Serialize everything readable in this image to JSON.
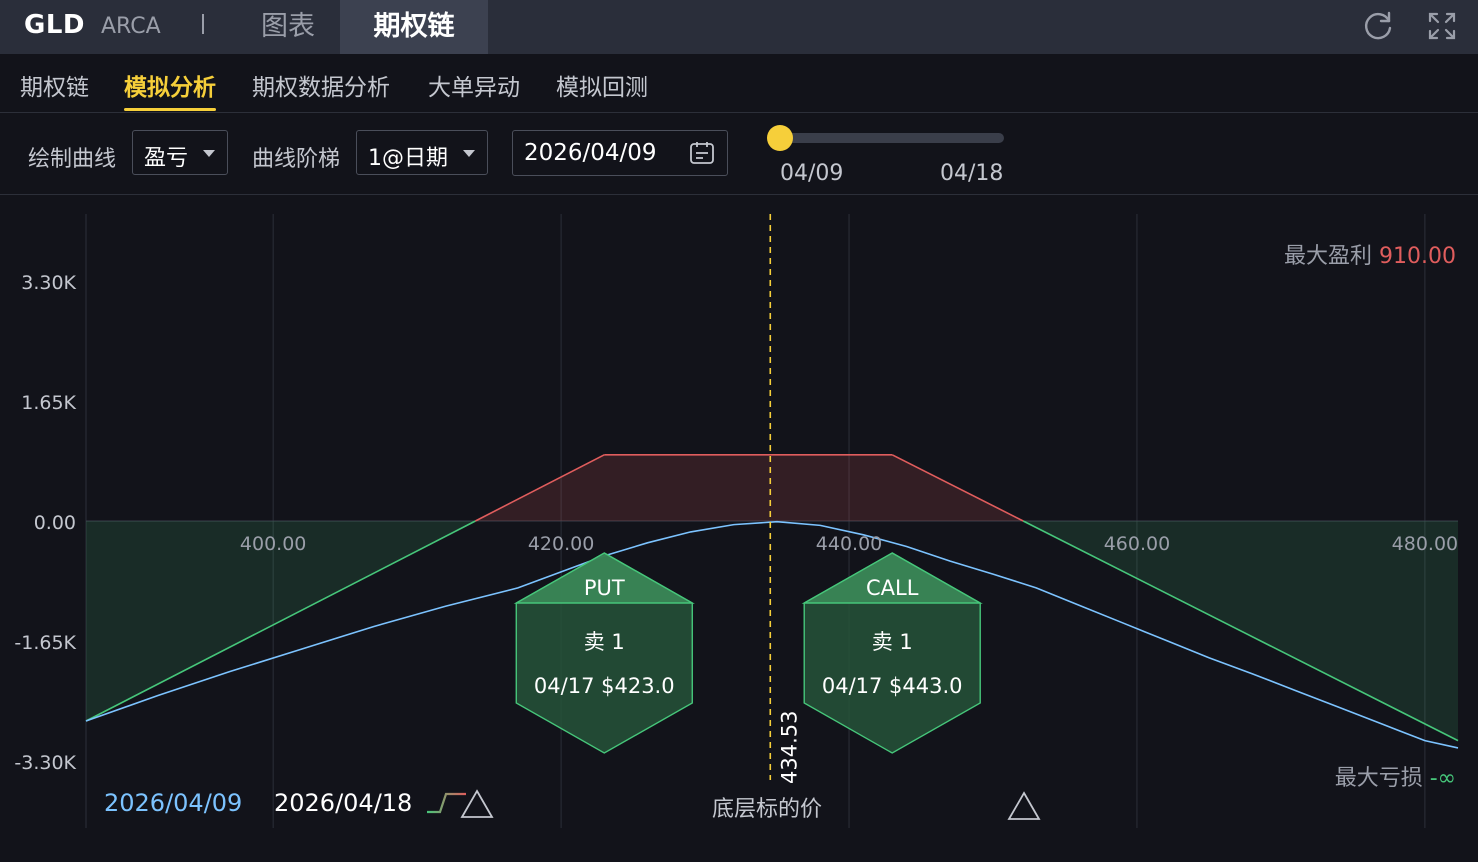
{
  "header": {
    "ticker": "GLD",
    "exchange": "ARCA",
    "tabs": [
      {
        "label": "图表",
        "active": false
      },
      {
        "label": "期权链",
        "active": true
      }
    ],
    "icons": [
      "refresh-icon",
      "expand-icon"
    ]
  },
  "subnav": {
    "tabs": [
      {
        "label": "期权链",
        "active": false
      },
      {
        "label": "模拟分析",
        "active": true
      },
      {
        "label": "期权数据分析",
        "active": false
      },
      {
        "label": "大单异动",
        "active": false
      },
      {
        "label": "模拟回测",
        "active": false
      }
    ]
  },
  "controls": {
    "curve_label": "绘制曲线",
    "curve_value": "盈亏",
    "step_label": "曲线阶梯",
    "step_value": "1@日期",
    "date_value": "2026/04/09",
    "slider_start": "04/09",
    "slider_end": "04/18",
    "slider_fraction": 0
  },
  "chart_data": {
    "type": "line",
    "x_ticks": [
      400,
      420,
      440,
      460,
      480
    ],
    "x_tick_labels": [
      "400.00",
      "420.00",
      "440.00",
      "460.00",
      "480.00"
    ],
    "y_ticks": [
      3300,
      1650,
      0,
      -1650,
      -3300
    ],
    "y_tick_labels": [
      "3.30K",
      "1.65K",
      "0.00",
      "-1.65K",
      "-3.30K"
    ],
    "xlim": [
      387,
      482.3
    ],
    "ylim": [
      -3300,
      3300
    ],
    "underlying_price": 434.53,
    "underlying_label": "434.53",
    "underlying_axis_label": "底层标的价",
    "max_profit_label": "最大盈利",
    "max_profit_value": "910.00",
    "max_loss_label": "最大亏损",
    "max_loss_value": "-∞",
    "series": [
      {
        "name": "2026/04/18",
        "color": "#46c67a",
        "profit_color": "#e05d5d",
        "x": [
          387,
          423,
          443,
          482.3
        ],
        "y": [
          -2750,
          910,
          910,
          -3020
        ]
      },
      {
        "name": "2026/04/09",
        "color": "#7cc3ff",
        "x": [
          387,
          392,
          397,
          402,
          407,
          412,
          417,
          420,
          423,
          426,
          429,
          432,
          435,
          438,
          441,
          444,
          447,
          450,
          453,
          456,
          459,
          462,
          465,
          468,
          471,
          474,
          477,
          480,
          482.3
        ],
        "y": [
          -2750,
          -2400,
          -2070,
          -1760,
          -1450,
          -1170,
          -920,
          -700,
          -480,
          -300,
          -150,
          -50,
          -10,
          -60,
          -190,
          -350,
          -550,
          -730,
          -920,
          -1160,
          -1400,
          -1640,
          -1880,
          -2100,
          -2330,
          -2560,
          -2790,
          -3020,
          -3120
        ]
      }
    ],
    "legends": [
      {
        "date": "2026/04/09",
        "color": "#7cc3ff"
      },
      {
        "date": "2026/04/18",
        "color": "#ffffff"
      }
    ],
    "legs": [
      {
        "type": "PUT",
        "action": "卖 1",
        "detail": "04/17 $423.0",
        "strike": 423,
        "color": "#46c67a"
      },
      {
        "type": "CALL",
        "action": "卖 1",
        "detail": "04/17 $443.0",
        "strike": 443,
        "color": "#46c67a"
      }
    ]
  }
}
